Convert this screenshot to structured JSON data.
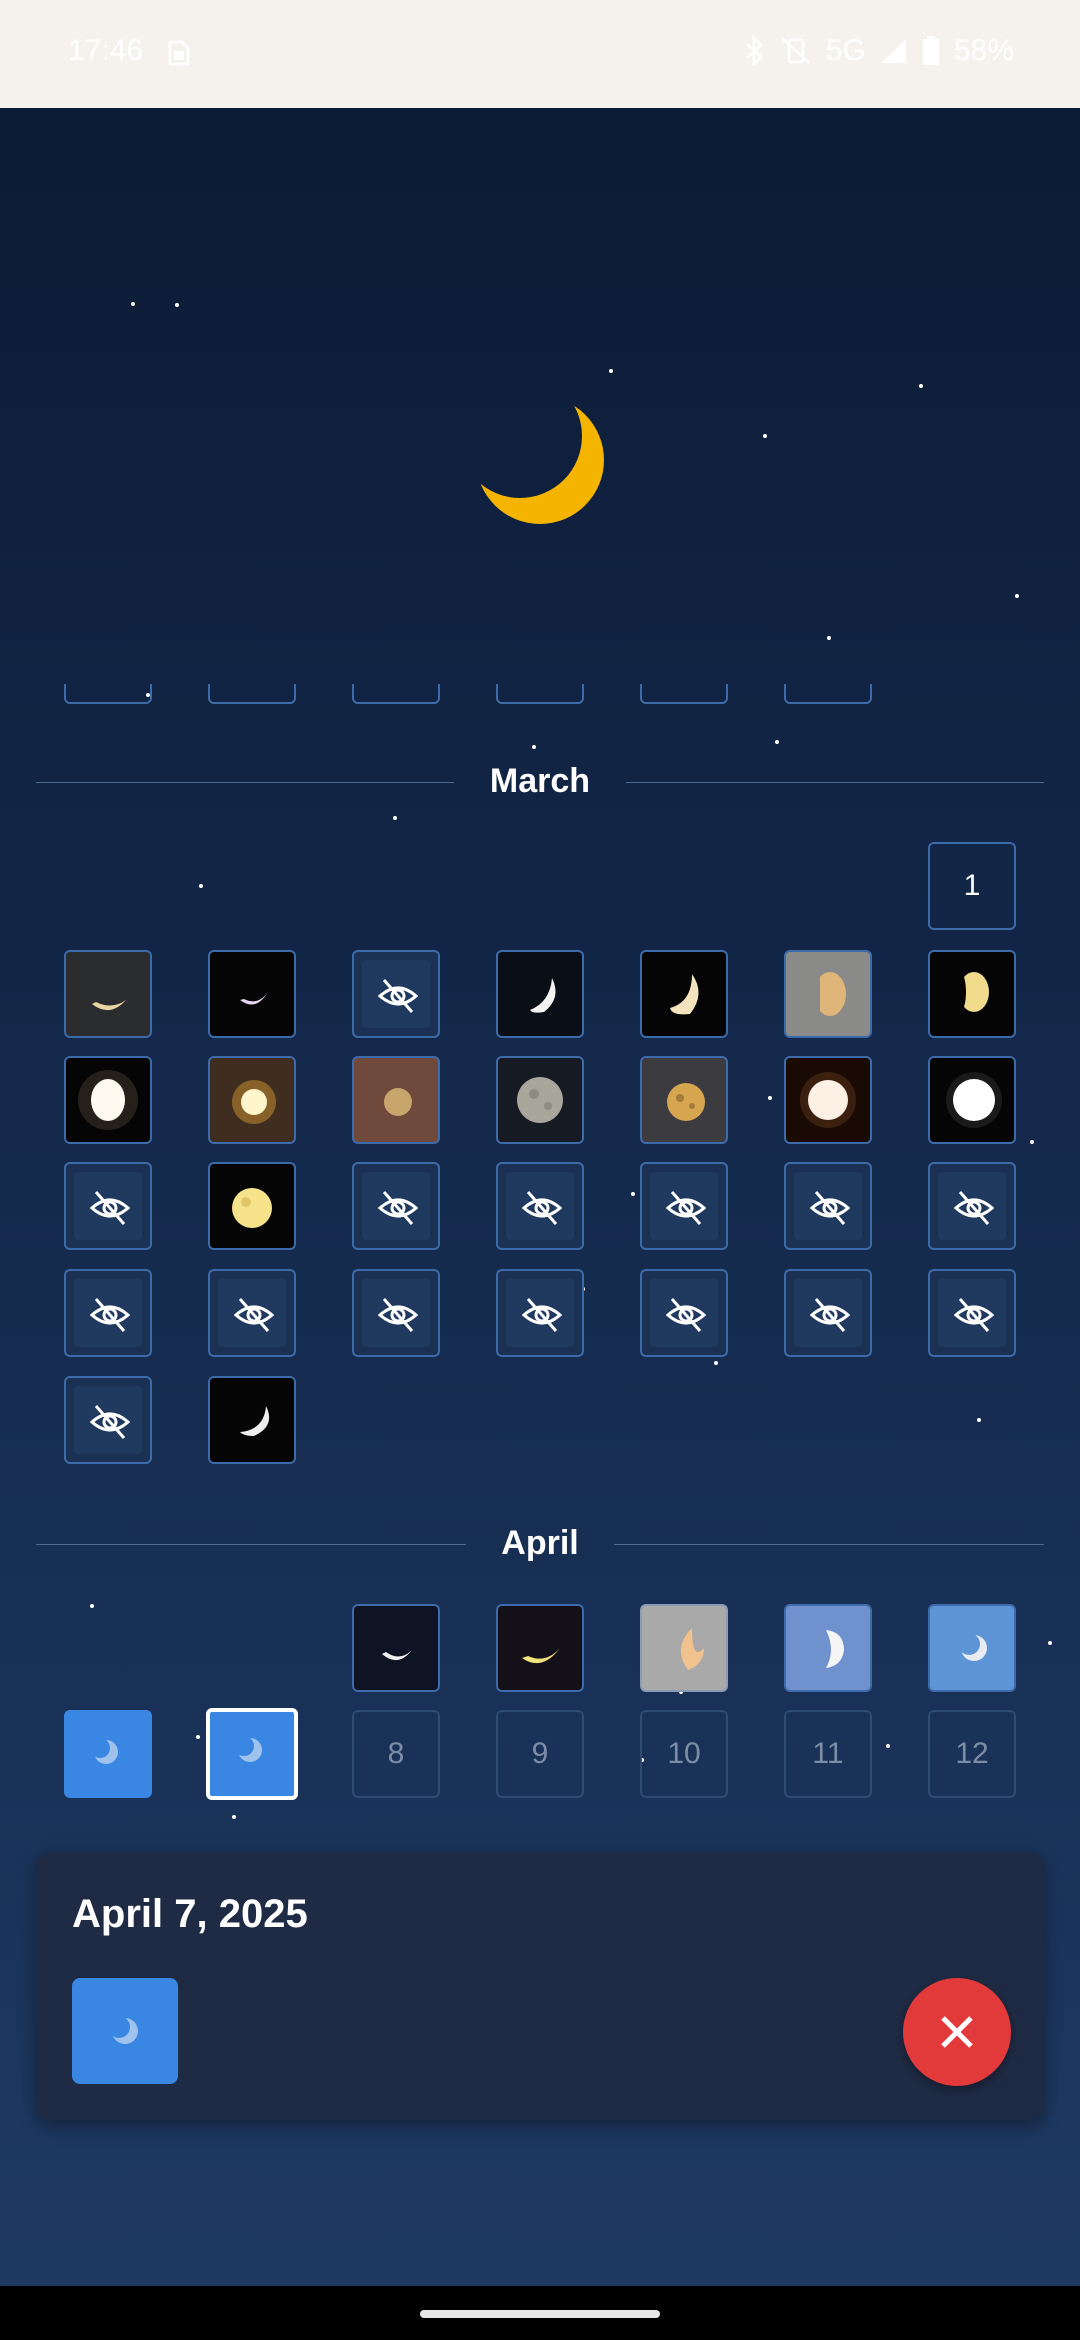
{
  "status_bar": {
    "time": "17:46",
    "network": "5G",
    "battery": "58%",
    "icons": [
      "sim-icon",
      "bluetooth-icon",
      "vibrate-off-icon",
      "signal-icon",
      "battery-icon"
    ]
  },
  "hero": {
    "icon": "crescent-moon-icon",
    "color": "#f4b400"
  },
  "months": [
    {
      "label": "March"
    },
    {
      "label": "April"
    }
  ],
  "march": {
    "first_day": "1"
  },
  "april": {
    "days": [
      "8",
      "9",
      "10",
      "11",
      "12"
    ]
  },
  "detail_card": {
    "date": "April 7, 2025"
  },
  "colors": {
    "accent_blue": "#3a87e3",
    "close_red": "#e23a3a",
    "cell_border": "#3d6aa8",
    "background_top": "#0b1a33"
  }
}
